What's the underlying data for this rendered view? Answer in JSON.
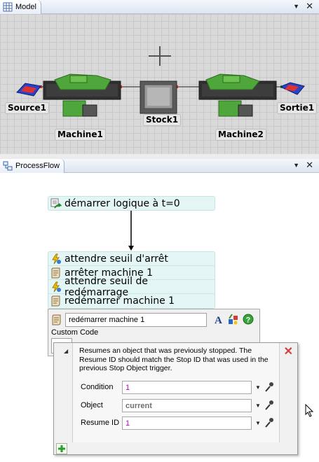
{
  "model_pane": {
    "tab_label": "Model",
    "objects": {
      "source": "Source1",
      "machine1": "Machine1",
      "stock": "Stock1",
      "machine2": "Machine2",
      "sink": "Sortie1"
    }
  },
  "processflow_pane": {
    "tab_label": "ProcessFlow",
    "start_block": "démarrer logique à t=0",
    "activities": [
      {
        "label": "attendre seuil d'arrêt",
        "icon": "event-trigger-icon"
      },
      {
        "label": "arrêter machine 1",
        "icon": "custom-code-icon"
      },
      {
        "label": "attendre seuil de redémarrage",
        "icon": "event-trigger-icon"
      },
      {
        "label": "redémarrer machine 1",
        "icon": "custom-code-icon"
      }
    ]
  },
  "properties": {
    "name_value": "redémarrer machine 1",
    "custom_code_label": "Custom Code",
    "description": "Resumes an object that was previously stopped.  The Resume ID should match the Stop ID that was used in the previous Stop Object trigger.",
    "fields": [
      {
        "label": "Condition",
        "value": "1"
      },
      {
        "label": "Object",
        "value": "current"
      },
      {
        "label": "Resume ID",
        "value": "1"
      }
    ]
  },
  "pane_controls": {
    "dropdown": "▼",
    "close": "✕"
  },
  "colors": {
    "accent": "#2a66c8",
    "block_fill": "#e3f5f5",
    "machine_green": "#3c8f2a",
    "close_red": "#d04040"
  }
}
